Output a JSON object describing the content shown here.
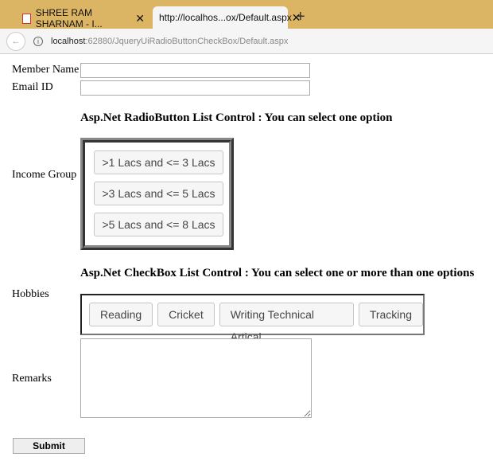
{
  "browser": {
    "tabs": [
      {
        "label": "SHREE RAM SHARNAM - I..."
      },
      {
        "label": "http://localhos...ox/Default.aspx"
      }
    ],
    "url_host": "localhost",
    "url_rest": ":62880/JqueryUiRadioButtonCheckBox/Default.aspx"
  },
  "form": {
    "member_name_label": "Member Name",
    "email_label": "Email ID",
    "radio_heading": "Asp.Net RadioButton List Control : You can select one option",
    "income_label": "Income Group",
    "income_options": [
      ">1 Lacs and <= 3 Lacs",
      ">3 Lacs and <= 5 Lacs",
      ">5 Lacs and <= 8 Lacs"
    ],
    "checkbox_heading": "Asp.Net CheckBox List Control : You can select one or more than one options",
    "hobbies_label": "Hobbies",
    "hobbies": [
      "Reading",
      "Cricket",
      "Writing Technical Artical",
      "Tracking"
    ],
    "remarks_label": "Remarks",
    "submit_label": "Submit"
  }
}
